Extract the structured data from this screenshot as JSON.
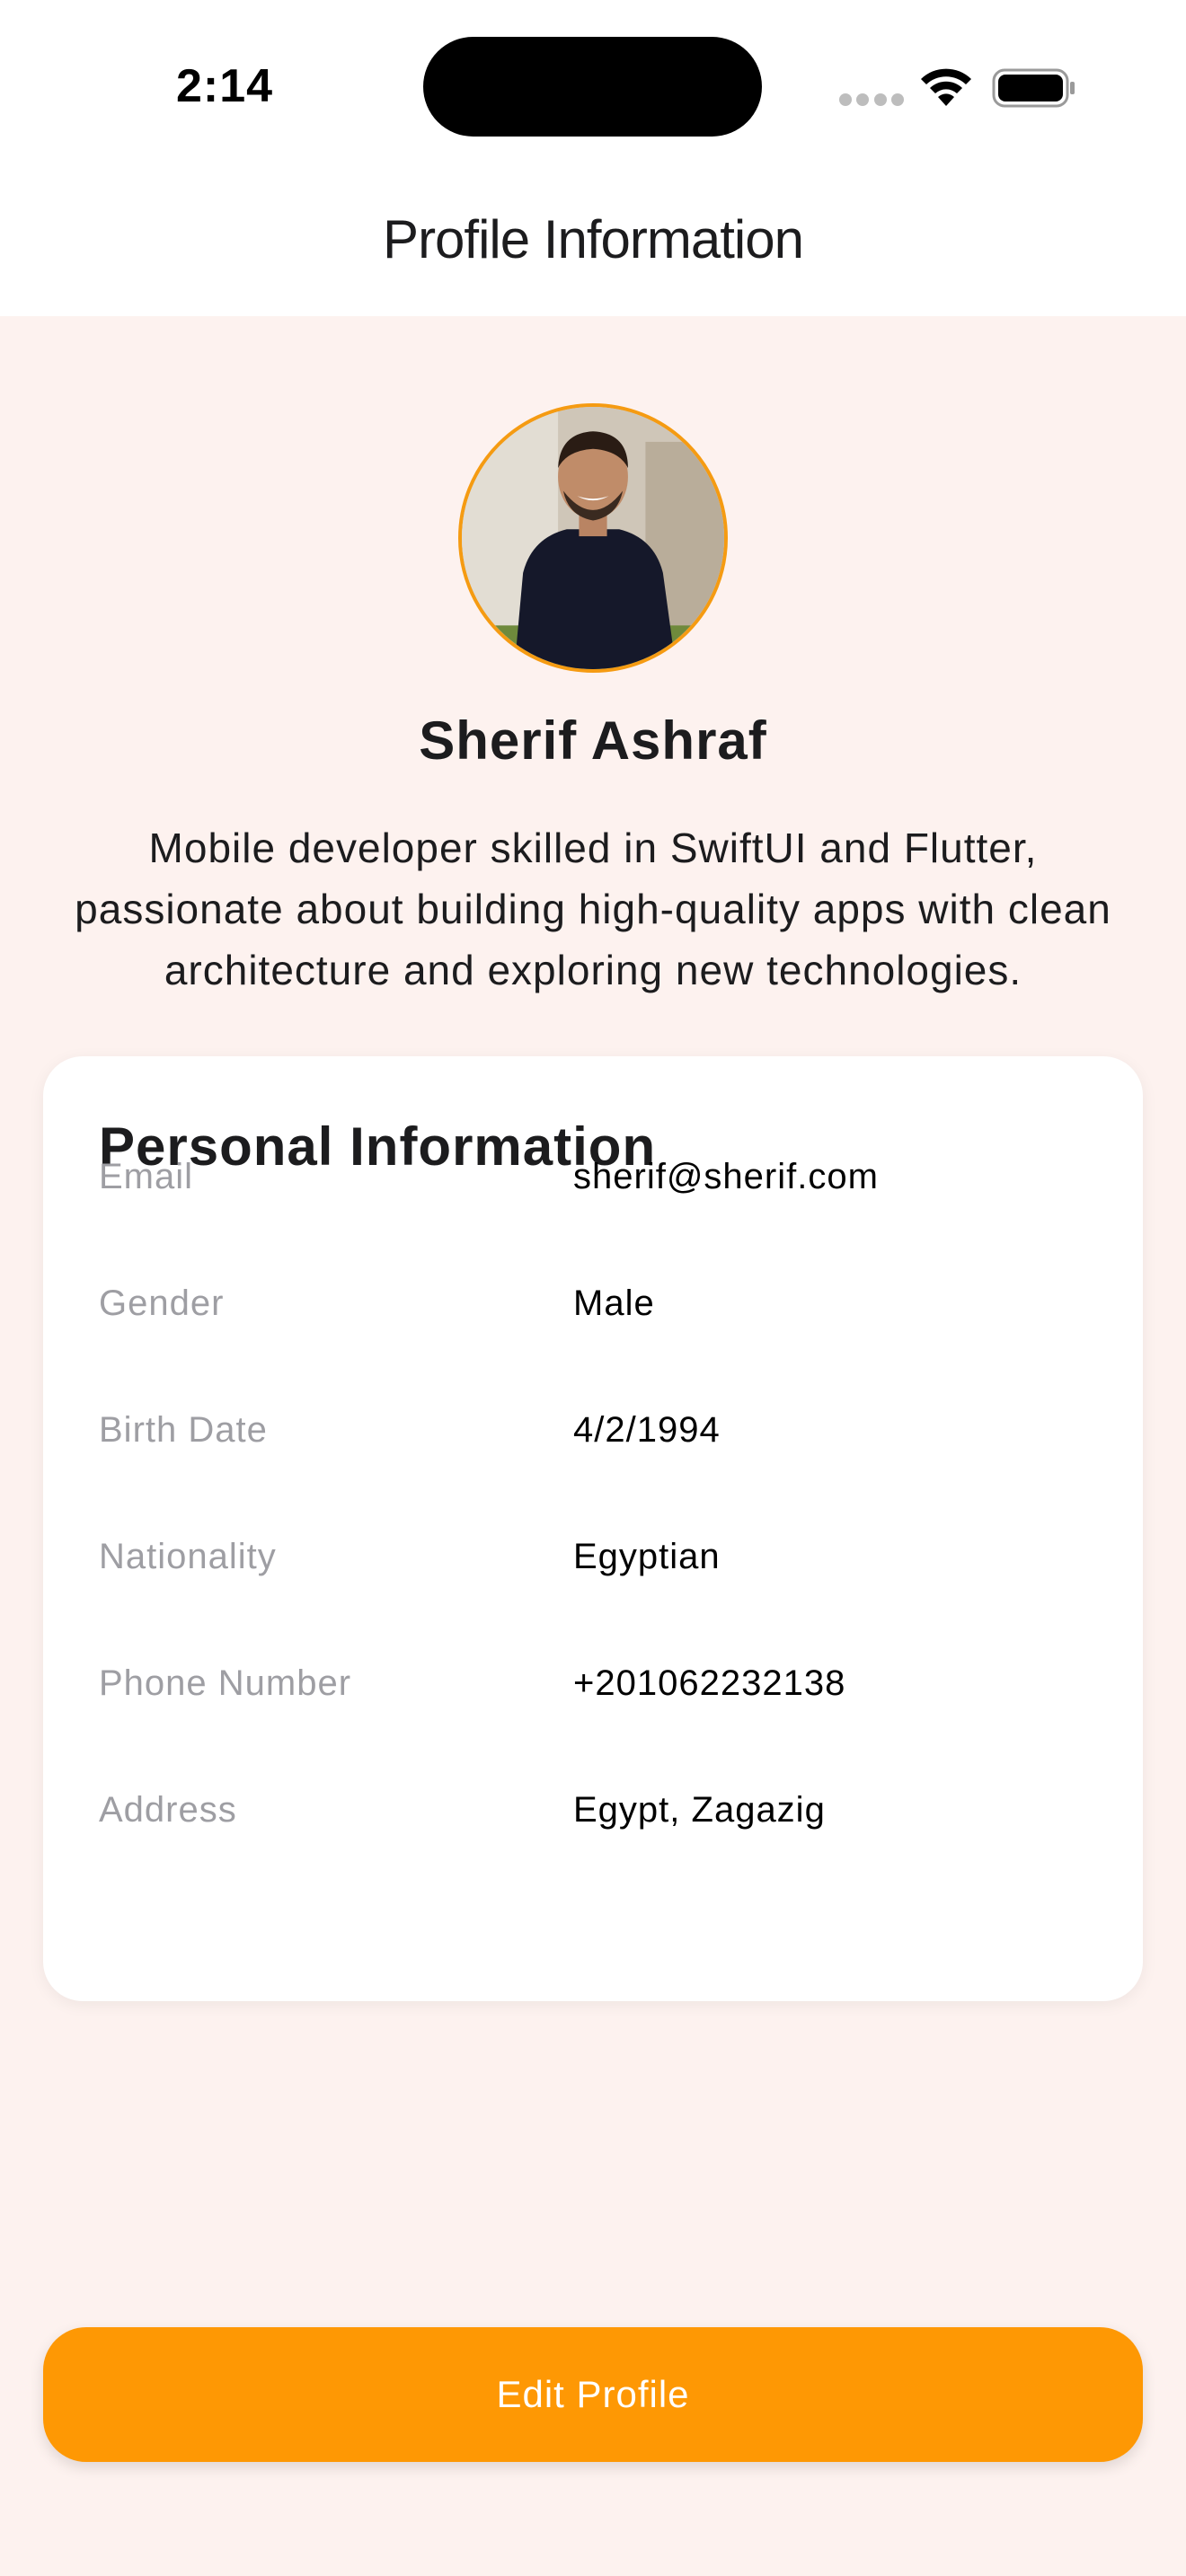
{
  "status_bar": {
    "time": "2:14",
    "wifi_icon": "wifi-icon",
    "battery_icon": "battery-full-icon",
    "cell_icon": "cellular-signal-icon"
  },
  "nav": {
    "title": "Profile Information"
  },
  "profile": {
    "name": "Sherif Ashraf",
    "bio": "Mobile developer skilled in SwiftUI and Flutter, passionate about building high-quality apps with clean architecture and exploring new technologies.",
    "avatar_border_color": "#f59b12"
  },
  "personal_info": {
    "title": "Personal Information",
    "rows": [
      {
        "label": "Email",
        "value": "sherif@sherif.com"
      },
      {
        "label": "Gender",
        "value": "Male"
      },
      {
        "label": "Birth Date",
        "value": "4/2/1994"
      },
      {
        "label": "Nationality",
        "value": "Egyptian"
      },
      {
        "label": "Phone Number",
        "value": "+201062232138"
      },
      {
        "label": "Address",
        "value": "Egypt, Zagazig"
      }
    ]
  },
  "actions": {
    "edit_profile_label": "Edit Profile",
    "accent_color": "#fe9804"
  },
  "colors": {
    "background": "#fdf2ef",
    "card": "#ffffff",
    "label_gray": "#9e9ea3"
  }
}
